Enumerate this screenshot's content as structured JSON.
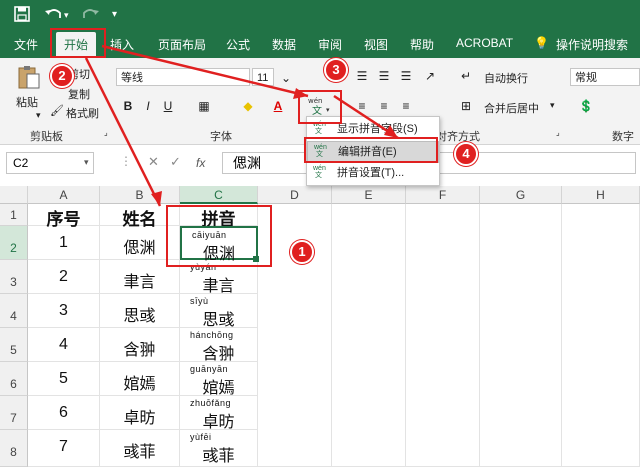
{
  "quick_access": {
    "save_icon": "save-icon",
    "undo_icon": "undo-icon",
    "redo_icon": "redo-icon",
    "customize_icon": "chevron-down-icon"
  },
  "tabs": [
    "文件",
    "开始",
    "插入",
    "页面布局",
    "公式",
    "数据",
    "审阅",
    "视图",
    "帮助",
    "ACROBAT"
  ],
  "tell_me": "操作说明搜索",
  "clipboard": {
    "paste": "粘贴",
    "cut": "剪切",
    "copy": "复制",
    "format_painter": "格式刷",
    "group": "剪贴板"
  },
  "font": {
    "name": "等线",
    "size": "11",
    "group": "字体",
    "bold": "B",
    "italic": "I",
    "underline": "U"
  },
  "alignment": {
    "wrap": "自动换行",
    "merge": "合并后居中",
    "group": "对齐方式"
  },
  "number": {
    "format": "常规",
    "group": "数字"
  },
  "phonetic_menu": {
    "show": "显示拼音字段(S)",
    "edit": "编辑拼音(E)",
    "settings": "拼音设置(T)..."
  },
  "name_box": "C2",
  "fx": "fx",
  "formula_value": "偲渊",
  "columns": [
    "A",
    "B",
    "C",
    "D",
    "E",
    "F",
    "G",
    "H"
  ],
  "rows": [
    "1",
    "2",
    "3",
    "4",
    "5",
    "6",
    "7",
    "8"
  ],
  "table": {
    "header": [
      "序号",
      "姓名",
      "拼音"
    ],
    "rows": [
      {
        "no": "1",
        "name": "偲渊",
        "pinyin": "cāiyuān",
        "chars": "偲渊"
      },
      {
        "no": "2",
        "name": "聿言",
        "pinyin": "yùyán",
        "chars": "聿言"
      },
      {
        "no": "3",
        "name": "思彧",
        "pinyin": "sīyù",
        "chars": "思彧"
      },
      {
        "no": "4",
        "name": "含翀",
        "pinyin": "hánchōng",
        "chars": "含翀"
      },
      {
        "no": "5",
        "name": "婠嫣",
        "pinyin": "guānyān",
        "chars": "婠嫣"
      },
      {
        "no": "6",
        "name": "卓昉",
        "pinyin": "zhuōfǎng",
        "chars": "卓昉"
      },
      {
        "no": "7",
        "name": "彧菲",
        "pinyin": "yùfēi",
        "chars": "彧菲"
      }
    ]
  },
  "annotations": [
    "1",
    "2",
    "3",
    "4"
  ],
  "colors": {
    "excel_green": "#217346",
    "annotation_red": "#e02020"
  }
}
